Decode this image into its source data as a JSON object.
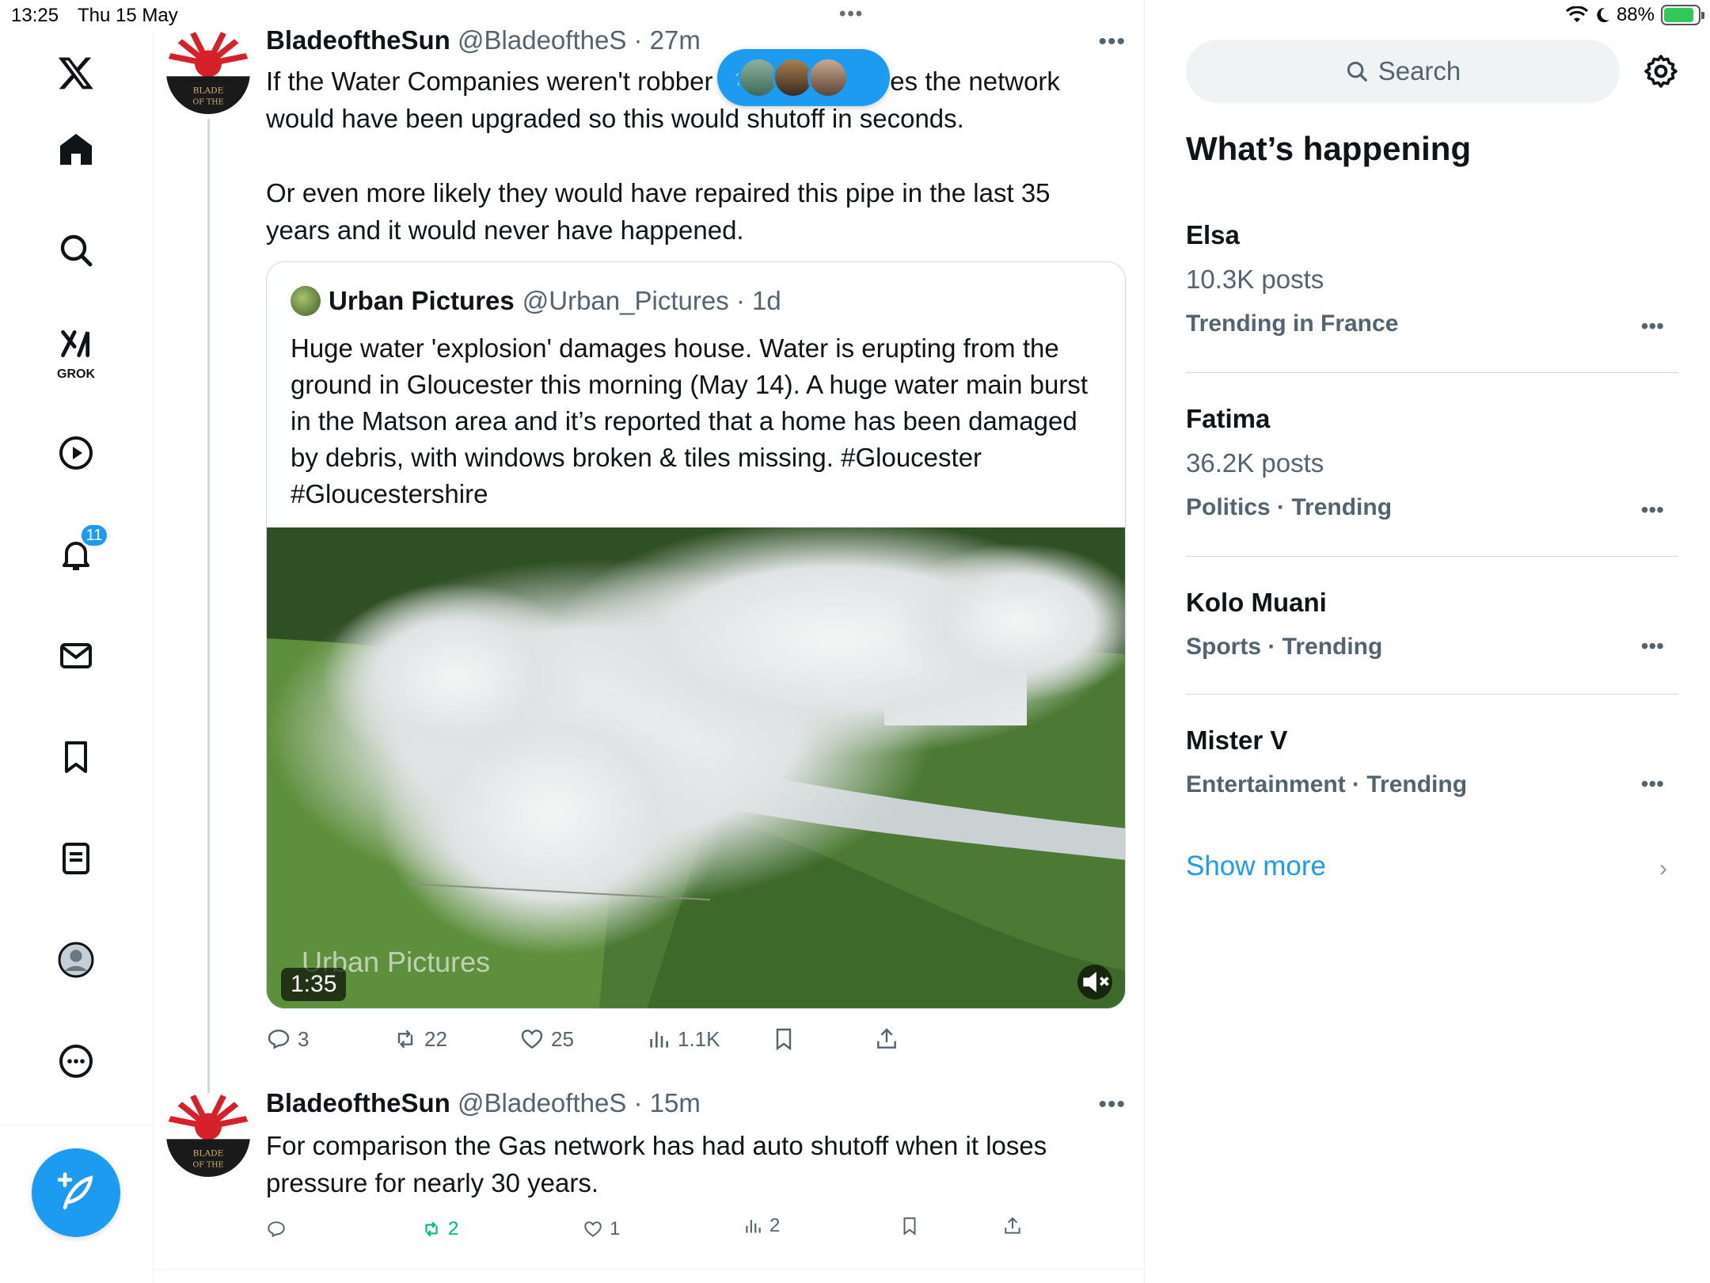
{
  "status_bar": {
    "time": "13:25",
    "date": "Thu 15 May",
    "battery": "88%",
    "battery_level": 0.88
  },
  "nav": {
    "grok_label": "GROK",
    "notifications_badge": "11",
    "items": [
      "x-logo",
      "home-icon",
      "search-icon",
      "grok-icon",
      "video-icon",
      "notifications-icon",
      "messages-icon",
      "bookmarks-icon",
      "lists-icon",
      "profile-icon",
      "more-icon"
    ]
  },
  "pill": {
    "arrow": "↑"
  },
  "tweets": [
    {
      "name": "BladeoftheSun",
      "handle": "@BladeoftheS",
      "sep": " · ",
      "time": "27m",
      "text": "If the Water Companies weren't robber baron billionaires the network would have been upgraded so this would shutoff in seconds.\n\nOr even more likely they would have repaired this pipe in the last 35 years and it would never have happened.",
      "quote": {
        "name": "Urban Pictures",
        "handle": "@Urban_Pictures",
        "sep": " · ",
        "time": "1d",
        "text": "Huge water 'explosion' damages house. Water is erupting from the ground in Gloucester this morning (May 14). A huge water main burst in the Matson area and it’s reported that a home has been damaged by debris, with windows broken & tiles missing. #Gloucester #Gloucestershire",
        "watermark": "Urban Pictures",
        "duration": "1:35"
      },
      "actions": {
        "replies": "3",
        "reposts": "22",
        "likes": "25",
        "views": "1.1K"
      }
    },
    {
      "name": "BladeoftheSun",
      "handle": "@BladeoftheS",
      "sep": " · ",
      "time": "15m",
      "text": "For comparison the Gas network has had auto shutoff when it loses pressure for nearly 30 years.",
      "actions": {
        "replies": "",
        "reposts": "2",
        "likes": "1",
        "views": "2"
      }
    }
  ],
  "right": {
    "search_placeholder": "Search",
    "panel_title": "What’s happening",
    "trends": [
      {
        "title": "Elsa",
        "count": "10.3K posts",
        "meta": "Trending in France"
      },
      {
        "title": "Fatima",
        "count": "36.2K posts",
        "meta": "Politics · Trending"
      },
      {
        "title": "Kolo Muani",
        "count": "",
        "meta": "Sports · Trending"
      },
      {
        "title": "Mister V",
        "count": "",
        "meta": "Entertainment · Trending"
      }
    ],
    "show_more": "Show more"
  },
  "colors": {
    "accent": "#1d9bf0",
    "muted": "#536471",
    "repost_active": "#00ba7c"
  }
}
